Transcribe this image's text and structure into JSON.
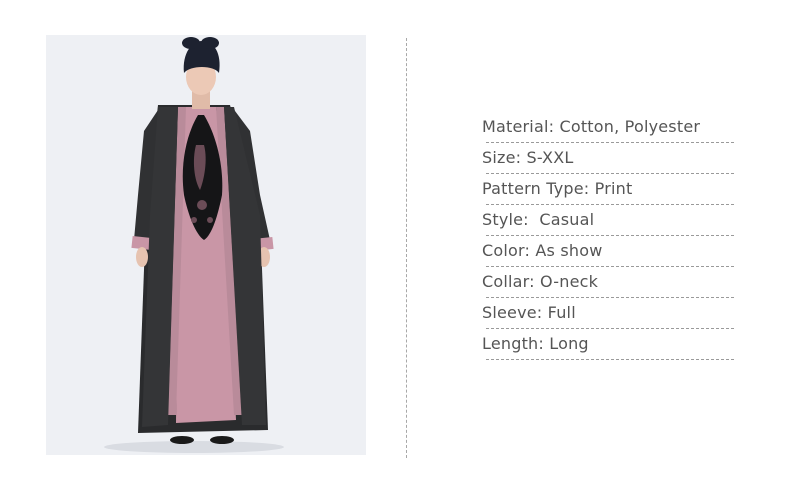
{
  "product": {
    "image_alt": "Model wearing black open abaya over pink embroidered maxi dress with dark turban"
  },
  "specs": [
    {
      "text": "Material: Cotton, Polyester"
    },
    {
      "text": "Size: S-XXL"
    },
    {
      "text": "Pattern Type: Print"
    },
    {
      "text": "Style:  Casual"
    },
    {
      "text": "Color: As show"
    },
    {
      "text": "Collar: O-neck"
    },
    {
      "text": "Sleeve: Full"
    },
    {
      "text": "Length: Long"
    }
  ],
  "colors": {
    "abaya": "#2e2f31",
    "inner_dress": "#c996a6",
    "turban": "#1d2230",
    "embroidery": "#141416",
    "background": "#eef0f4"
  }
}
